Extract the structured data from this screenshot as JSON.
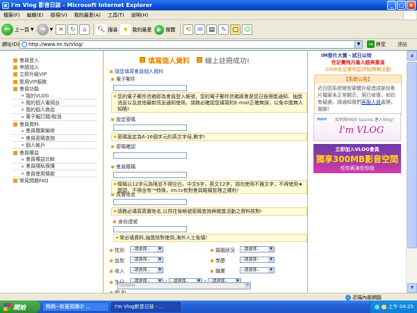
{
  "window": {
    "title": "I'm Vlog 影音日誌 - Microsoft Internet Explorer"
  },
  "menu": [
    "檔案(F)",
    "編輯(E)",
    "檢視(V)",
    "我的最愛(A)",
    "工具(T)",
    "說明(H)"
  ],
  "toolbar": {
    "back": "上一頁",
    "search": "搜尋",
    "favorites": "我的最愛",
    "media": "媒體"
  },
  "address": {
    "label": "網址(D)",
    "url": "http://www.im.tv/Vlog/",
    "go": "移至",
    "links": "連結"
  },
  "sidebar": {
    "items": [
      {
        "label": "會員登入",
        "level": 1
      },
      {
        "label": "申請加入",
        "level": 1
      },
      {
        "label": "立即升級VIP",
        "level": 1
      },
      {
        "label": "暫用VIP服務",
        "level": 1
      },
      {
        "label": "會員功能",
        "level": 1
      },
      {
        "label": "我的VLOG",
        "level": 2
      },
      {
        "label": "我的個人電視台",
        "level": 2
      },
      {
        "label": "我的個人商店",
        "level": 2
      },
      {
        "label": "電子報訂閱/取消",
        "level": 2
      },
      {
        "label": "會員資料",
        "level": 1
      },
      {
        "label": "會員檔案編修",
        "level": 2
      },
      {
        "label": "會員密碼查詢",
        "level": 2
      },
      {
        "label": "個人帳戶",
        "level": 2
      },
      {
        "label": "會員權益",
        "level": 1
      },
      {
        "label": "會員權益比較",
        "level": 2
      },
      {
        "label": "會員隱私保護",
        "level": 2
      },
      {
        "label": "會員使用條款",
        "level": 2
      },
      {
        "label": "常見問題FAQ",
        "level": 1
      }
    ]
  },
  "form": {
    "heading": "填寫個人資料",
    "heading_sub": "線上註冊成功!",
    "section_title": "請您填寫會員個人資料",
    "email_label": "電子郵件",
    "email_note": "您的電子郵件信箱即為會員登入帳號，您的電子郵件信箱將會是您日後得獎通知、抽獎消息以及其他最新訊息通知使用，請務必確認您填寫的E-mail正確無誤，以免中獎無人知曉!",
    "password_label": "設定密碼",
    "password_note": "密碼設定為6-16個字元的英文字母,數字!",
    "confirm_label": "密碼確認",
    "nickname_label": "會員暱稱",
    "nickname_note": "暱稱以12字元為限並不得空白，中文6字，英文12字，請勿使用不雅文字，不得使用★闆頭，不得含有\"*特殊，im.tv有對會員暱稱管理之權利!",
    "realname_label": "真實姓名",
    "realname_note": "請務必填寫真實姓名,以供往後帳號密碼查詢與贈獎活動之資料核對!",
    "id_label": "身份證號",
    "id_note": "常必填資料,抽獎核對使用,海外人士免填!",
    "gender_label": "性別",
    "marital_label": "婚姻狀況",
    "blood_label": "血型",
    "education_label": "學歷",
    "income_label": "收入",
    "occupation_label": "職業",
    "birthday_label": "生日",
    "country_label": "國 別",
    "select_placeholder": "--請選擇--",
    "country_value": "TAIWAN",
    "date_sep": "/"
  },
  "right": {
    "promo1": "IM發片大賞・試日以待",
    "promo2": "世足賽飛月最人經典重溫",
    "promo3": "2006世足賽明星拼貼徵稿活動",
    "notice_title": "【系統公告】",
    "notice_body": "近日因系統微型硬體升級造成部份影片檔案未正常顯示，現已修復，如仍有疑慮，請通知我們",
    "notice_link": "客服人員",
    "notice_end": "處理，謝謝！",
    "ad1_msn": "msn",
    "ad1_text": "如何將MSN Spaces 連入Vlog?",
    "ad1_logo": "I'm VLOG",
    "ad2_line1": "立即加入VLOG會員",
    "ad2_line2": "獨享300MB影音空間",
    "ad2_line3": "任你表演任你說"
  },
  "statusbar": {
    "zone": "近端內部網路"
  },
  "taskbar": {
    "start": "開始",
    "task1": "鴨鴨~新書預購中 ...",
    "task2": "I'm Vlog影音日誌 - ...",
    "time": "上午 04:25"
  }
}
